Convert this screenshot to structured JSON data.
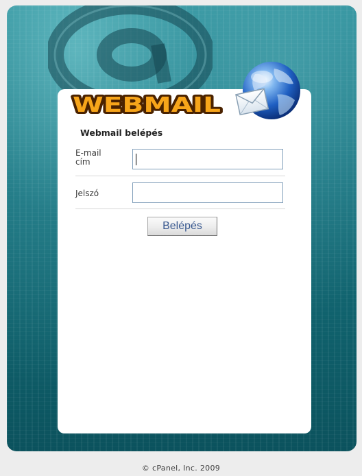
{
  "app": {
    "logo_text": "WEBMAIL"
  },
  "login": {
    "title": "Webmail belépés",
    "email_label": "E-mail cím",
    "email_value": "",
    "password_label": "Jelszó",
    "password_value": "",
    "submit_label": "Belépés"
  },
  "footer": {
    "copyright": "© cPanel, Inc. 2009"
  },
  "icons": {
    "background": "at-sign-icon",
    "globe": "globe-envelope-icon"
  },
  "colors": {
    "background_teal": "#17707c",
    "logo_fill": "#f7a51a",
    "logo_outline": "#4a2200",
    "button_text": "#38588f"
  }
}
